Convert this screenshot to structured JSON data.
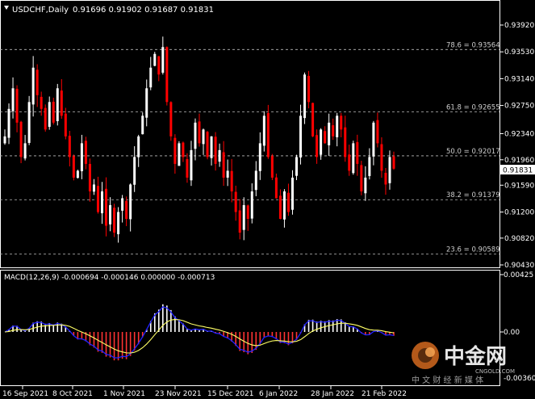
{
  "header": {
    "symbol": "USDCHF,Daily",
    "ohlc": "0.91696 0.91902 0.91687 0.91831"
  },
  "price_axis": {
    "labels": [
      "0.93920",
      "0.93530",
      "0.93140",
      "0.92750",
      "0.92340",
      "0.91960",
      "0.91590",
      "0.91200",
      "0.90820",
      "0.90430"
    ],
    "current_price": "0.91831"
  },
  "fib_levels": [
    {
      "label": "78.6 = 0.93564",
      "value": 0.93564
    },
    {
      "label": "61.8 = 0.92655",
      "value": 0.92655
    },
    {
      "label": "50.0 = 0.92017",
      "value": 0.92017
    },
    {
      "label": "38.2 = 0.91379",
      "value": 0.91379
    },
    {
      "label": "23.6 = 0.90589",
      "value": 0.90589
    }
  ],
  "macd": {
    "label": "MACD(12,26,9) -0.000694 -0.000146 0.000000 -0.000713",
    "axis_labels": [
      "0.00425",
      "0.00",
      "-0.003602"
    ]
  },
  "time_axis": [
    "16 Sep 2021",
    "8 Oct 2021",
    "1 Nov 2021",
    "23 Nov 2021",
    "15 Dec 2021",
    "6 Jan 2022",
    "28 Jan 2022",
    "21 Feb 2022"
  ],
  "watermark": {
    "brand": "中金网",
    "domain": "CNGOLD.COM",
    "tagline": "中 文 财 经 新 媒 体"
  },
  "colors": {
    "bull": "#ffffff",
    "bear": "#ff0000",
    "signal": "#ffff66",
    "macd_line": "#2222ff",
    "grid": "#ffffff",
    "background": "#000000"
  },
  "chart_data": {
    "type": "candlestick",
    "series_closes": [
      0.923,
      0.927,
      0.93,
      0.925,
      0.92,
      0.922,
      0.928,
      0.933,
      0.929,
      0.927,
      0.924,
      0.928,
      0.925,
      0.93,
      0.926,
      0.923,
      0.92,
      0.917,
      0.918,
      0.922,
      0.919,
      0.915,
      0.916,
      0.912,
      0.915,
      0.91,
      0.913,
      0.909,
      0.912,
      0.914,
      0.911,
      0.916,
      0.92,
      0.923,
      0.926,
      0.93,
      0.933,
      0.935,
      0.932,
      0.936,
      0.928,
      0.923,
      0.919,
      0.922,
      0.92,
      0.917,
      0.921,
      0.925,
      0.922,
      0.924,
      0.92,
      0.923,
      0.919,
      0.921,
      0.917,
      0.918,
      0.915,
      0.912,
      0.909,
      0.913,
      0.911,
      0.915,
      0.918,
      0.922,
      0.926,
      0.92,
      0.917,
      0.914,
      0.911,
      0.915,
      0.912,
      0.917,
      0.92,
      0.926,
      0.932,
      0.928,
      0.923,
      0.92,
      0.924,
      0.922,
      0.925,
      0.923,
      0.926,
      0.924,
      0.92,
      0.918,
      0.922,
      0.919,
      0.915,
      0.917,
      0.92,
      0.925,
      0.922,
      0.918,
      0.916,
      0.92,
      0.9183
    ],
    "xlabels": [
      "16 Sep 2021",
      "8 Oct 2021",
      "1 Nov 2021",
      "23 Nov 2021",
      "15 Dec 2021",
      "6 Jan 2022",
      "28 Jan 2022",
      "21 Feb 2022"
    ],
    "ylim": [
      0.9043,
      0.9392
    ],
    "last": {
      "open": 0.91696,
      "high": 0.91902,
      "low": 0.91687,
      "close": 0.91831
    }
  }
}
